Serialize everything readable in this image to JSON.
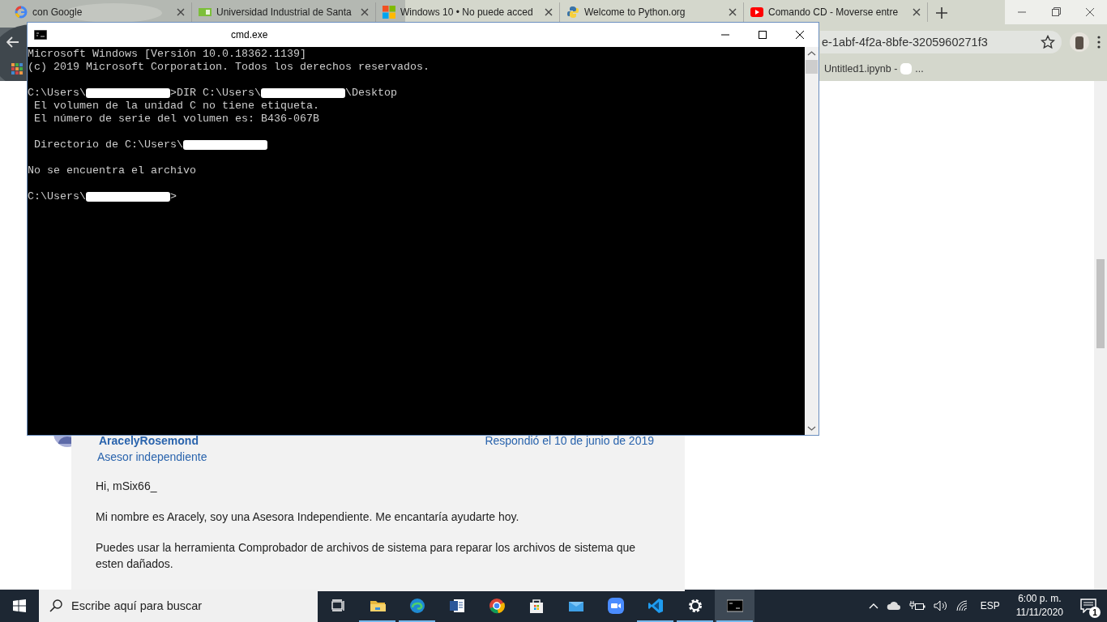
{
  "browser": {
    "tabs": [
      {
        "kind": "google",
        "label": "con Google",
        "selected": false
      },
      {
        "kind": "grid",
        "label": "Universidad Industrial de Santa",
        "selected": false
      },
      {
        "kind": "windows",
        "label": "Windows 10 • No puede acced",
        "selected": false
      },
      {
        "kind": "python",
        "label": "Welcome to Python.org",
        "selected": false
      },
      {
        "kind": "video",
        "label": "Comando CD - Moverse entre",
        "selected": false
      }
    ],
    "address_bar": {
      "value": "e-1abf-4f2a-8bfe-3205960271f3"
    },
    "bookmarks": [
      {
        "label": "Untitled1.ipynb -",
        "suffix": "..."
      }
    ]
  },
  "forum_post": {
    "author": "AracelyRosemond",
    "role": "Asesor independiente",
    "date": "Respondió el 10 de junio de 2019",
    "paragraphs": [
      "Hi, mSix66_",
      "Mi nombre es Aracely, soy una Asesora Independiente. Me encantaría ayudarte hoy.",
      "Puedes usar la herramienta Comprobador de archivos de sistema para reparar los archivos de sistema que esten dañados."
    ]
  },
  "cmd_window": {
    "title": "cmd.exe",
    "lines": [
      {
        "kind": "text",
        "parts": [
          {
            "kind": "text",
            "text": "Microsoft Windows [Versión 10.0.18362.1139]"
          }
        ]
      },
      {
        "kind": "text",
        "parts": [
          {
            "kind": "text",
            "text": "(c) 2019 Microsoft Corporation. Todos los derechos reservados."
          }
        ]
      },
      {
        "kind": "blank"
      },
      {
        "kind": "text",
        "parts": [
          {
            "kind": "text",
            "text": "C:\\Users\\"
          },
          {
            "kind": "redacted"
          },
          {
            "kind": "text",
            "text": ">DIR C:\\Users\\"
          },
          {
            "kind": "redacted"
          },
          {
            "kind": "text",
            "text": "\\Desktop"
          }
        ]
      },
      {
        "kind": "text",
        "parts": [
          {
            "kind": "text",
            "text": " El volumen de la unidad C no tiene etiqueta."
          }
        ]
      },
      {
        "kind": "text",
        "parts": [
          {
            "kind": "text",
            "text": " El número de serie del volumen es: B436-067B"
          }
        ]
      },
      {
        "kind": "blank"
      },
      {
        "kind": "text",
        "parts": [
          {
            "kind": "text",
            "text": " Directorio de C:\\Users\\"
          },
          {
            "kind": "redacted"
          }
        ]
      },
      {
        "kind": "blank"
      },
      {
        "kind": "text",
        "parts": [
          {
            "kind": "text",
            "text": "No se encuentra el archivo"
          }
        ]
      },
      {
        "kind": "blank"
      },
      {
        "kind": "text",
        "parts": [
          {
            "kind": "text",
            "text": "C:\\Users\\"
          },
          {
            "kind": "redacted"
          },
          {
            "kind": "text",
            "text": ">"
          }
        ]
      }
    ]
  },
  "taskbar": {
    "search": {
      "placeholder": "Escribe aquí para buscar"
    },
    "apps": [
      {
        "kind": "taskview",
        "running": false,
        "selected": false
      },
      {
        "kind": "folder",
        "running": true,
        "selected": false
      },
      {
        "kind": "edge",
        "running": true,
        "selected": false
      },
      {
        "kind": "word",
        "running": false,
        "selected": false
      },
      {
        "kind": "chrome",
        "running": false,
        "selected": false
      },
      {
        "kind": "store",
        "running": false,
        "selected": false
      },
      {
        "kind": "mail",
        "running": false,
        "selected": false
      },
      {
        "kind": "zoom",
        "running": false,
        "selected": false
      },
      {
        "kind": "vscode",
        "running": true,
        "selected": false
      },
      {
        "kind": "settings",
        "running": true,
        "selected": false
      },
      {
        "kind": "terminal",
        "running": true,
        "selected": true
      }
    ],
    "language": "ESP",
    "time": "6:00 p. m.",
    "date": "11/11/2020",
    "notifications": "1"
  }
}
